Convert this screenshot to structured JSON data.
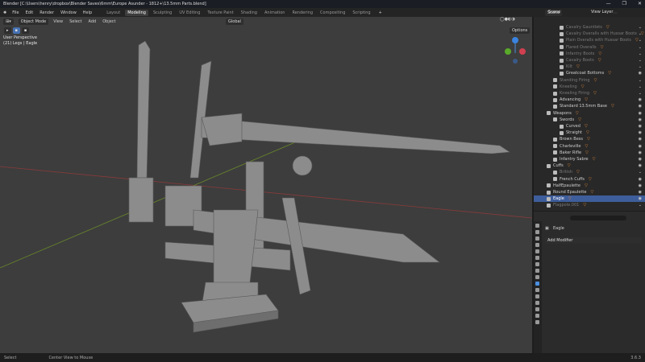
{
  "title": "Blender [C:\\Users\\henry\\dropbox\\Blender Saves\\6mm\\Europe Asunder - 1812+\\13.5mm Parts.blend]",
  "menu": [
    "File",
    "Edit",
    "Render",
    "Window",
    "Help"
  ],
  "workspaces": [
    "Layout",
    "Modeling",
    "Sculpting",
    "UV Editing",
    "Texture Paint",
    "Shading",
    "Animation",
    "Rendering",
    "Compositing",
    "Scripting"
  ],
  "active_workspace": "Modeling",
  "scene": "Scene",
  "view_layer": "View Layer",
  "viewport": {
    "mode": "Object Mode",
    "menus": [
      "View",
      "Select",
      "Add",
      "Object"
    ],
    "orientation": "Global",
    "options": "Options",
    "perspective": "User Perspective",
    "object_info": "(21) Legs | Eagle"
  },
  "outliner": [
    {
      "label": "Cavalry Gauntlets",
      "d": 4,
      "dim": true
    },
    {
      "label": "Cavalry Overalls with Hussar Boots",
      "d": 4,
      "dim": true
    },
    {
      "label": "Plain Overalls with Hussar Boots",
      "d": 4,
      "dim": true
    },
    {
      "label": "Flared Overalls",
      "d": 4,
      "dim": true
    },
    {
      "label": "Infantry Boots",
      "d": 4,
      "dim": true
    },
    {
      "label": "Cavalry Boots",
      "d": 4,
      "dim": true
    },
    {
      "label": "Kilt",
      "d": 4,
      "dim": true
    },
    {
      "label": "Greatcoat Bottoms",
      "d": 4,
      "dim": false
    },
    {
      "label": "Standing Firing",
      "d": 3,
      "dim": true
    },
    {
      "label": "Kneeling",
      "d": 3,
      "dim": true
    },
    {
      "label": "Kneeling Firing",
      "d": 3,
      "dim": true
    },
    {
      "label": "Advancing",
      "d": 3,
      "dim": false
    },
    {
      "label": "Standard 13.5mm Base",
      "d": 3,
      "dim": false
    },
    {
      "label": "Weapons",
      "d": 2,
      "dim": false
    },
    {
      "label": "Swords",
      "d": 3,
      "dim": false
    },
    {
      "label": "Curved",
      "d": 4,
      "dim": false
    },
    {
      "label": "Straight",
      "d": 4,
      "dim": false
    },
    {
      "label": "Brown Bess",
      "d": 3,
      "dim": false
    },
    {
      "label": "Charleville",
      "d": 3,
      "dim": false
    },
    {
      "label": "Baker Rifle",
      "d": 3,
      "dim": false
    },
    {
      "label": "Infantry Sabre",
      "d": 3,
      "dim": false
    },
    {
      "label": "Cuffs",
      "d": 2,
      "dim": false
    },
    {
      "label": "British",
      "d": 3,
      "dim": true
    },
    {
      "label": "French Cuffs",
      "d": 3,
      "dim": false
    },
    {
      "label": "HalfEpaulette",
      "d": 2,
      "dim": false
    },
    {
      "label": "Round Epaulette",
      "d": 2,
      "dim": false
    },
    {
      "label": "Eagle",
      "d": 2,
      "dim": false,
      "sel": true
    },
    {
      "label": "Flagpole.001",
      "d": 2,
      "dim": true
    }
  ],
  "properties": {
    "object": "Eagle",
    "add_modifier": "Add Modifier"
  },
  "status": {
    "select": "Select",
    "center": "Center View to Mouse",
    "version": "3.6.3"
  }
}
